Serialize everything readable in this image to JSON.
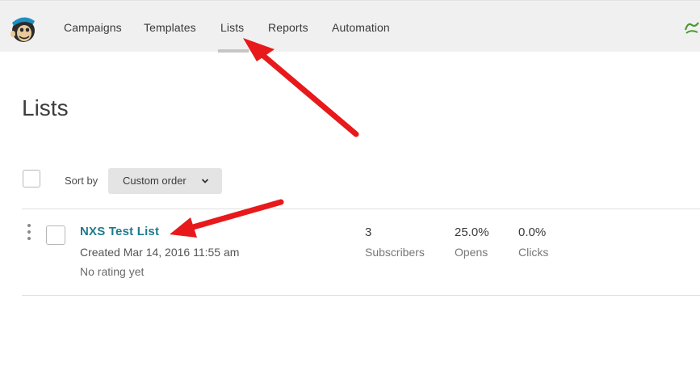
{
  "nav": {
    "items": [
      "Campaigns",
      "Templates",
      "Lists",
      "Reports",
      "Automation"
    ],
    "active": "Lists"
  },
  "page": {
    "title": "Lists"
  },
  "toolbar": {
    "sort_label": "Sort by",
    "sort_value": "Custom order"
  },
  "list_row": {
    "name": "NXS Test List",
    "created": "Created Mar 14, 2016 11:55 am",
    "rating": "No rating yet",
    "stats": [
      {
        "value": "3",
        "label": "Subscribers"
      },
      {
        "value": "25.0%",
        "label": "Opens"
      },
      {
        "value": "0.0%",
        "label": "Clicks"
      }
    ]
  },
  "colors": {
    "accent_link": "#1f7a8c",
    "annotation": "#e8191b",
    "nav_bg": "#f0f0f0"
  }
}
